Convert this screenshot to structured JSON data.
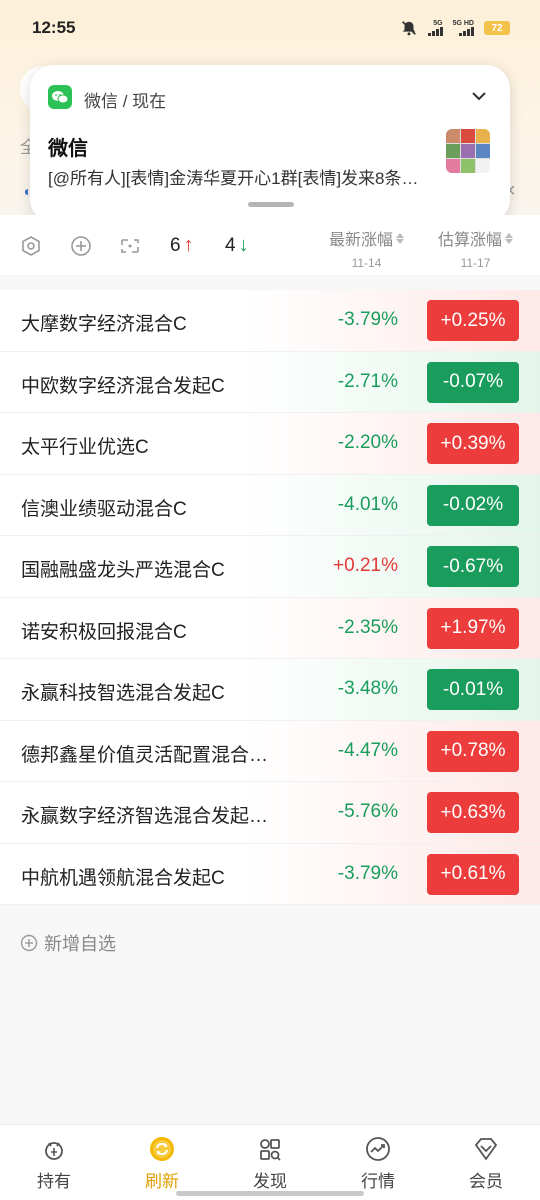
{
  "status_bar": {
    "time": "12:55",
    "signal1_label": "5G",
    "signal2_label": "5G HD",
    "battery": "72"
  },
  "notification": {
    "app_name": "微信 / 现在",
    "title": "微信",
    "body": "[@所有人][表情]金涛华夏开心1群[表情]发来8条…",
    "icon": "wechat-icon",
    "accent": "#2bc156"
  },
  "background_hints": {
    "all_tab": "全"
  },
  "toolbar": {
    "up_count": "6",
    "down_count": "4",
    "up_arrow": "↑",
    "down_arrow": "↓",
    "col_latest_label": "最新涨幅",
    "col_latest_date": "11-14",
    "col_estimate_label": "估算涨幅",
    "col_estimate_date": "11-17"
  },
  "funds": [
    {
      "name": "大摩数字经济混合C",
      "latest": "-3.79%",
      "estimate": "+0.25%"
    },
    {
      "name": "中欧数字经济混合发起C",
      "latest": "-2.71%",
      "estimate": "-0.07%"
    },
    {
      "name": "太平行业优选C",
      "latest": "-2.20%",
      "estimate": "+0.39%"
    },
    {
      "name": "信澳业绩驱动混合C",
      "latest": "-4.01%",
      "estimate": "-0.02%"
    },
    {
      "name": "国融融盛龙头严选混合C",
      "latest": "+0.21%",
      "estimate": "-0.67%"
    },
    {
      "name": "诺安积极回报混合C",
      "latest": "-2.35%",
      "estimate": "+1.97%"
    },
    {
      "name": "永赢科技智选混合发起C",
      "latest": "-3.48%",
      "estimate": "-0.01%"
    },
    {
      "name": "德邦鑫星价值灵活配置混合…",
      "latest": "-4.47%",
      "estimate": "+0.78%"
    },
    {
      "name": "永赢数字经济智选混合发起…",
      "latest": "-5.76%",
      "estimate": "+0.63%"
    },
    {
      "name": "中航机遇领航混合发起C",
      "latest": "-3.79%",
      "estimate": "+0.61%"
    }
  ],
  "add_fund_label": "新增自选",
  "bottom_nav": [
    {
      "label": "持有",
      "icon": "holdings-icon",
      "active": false
    },
    {
      "label": "刷新",
      "icon": "refresh-icon",
      "active": true
    },
    {
      "label": "发现",
      "icon": "discover-icon",
      "active": false
    },
    {
      "label": "行情",
      "icon": "market-icon",
      "active": false
    },
    {
      "label": "会员",
      "icon": "member-icon",
      "active": false
    }
  ],
  "colors": {
    "up": "#e23a3a",
    "down": "#1a9d5c",
    "active_nav": "#e0a100"
  }
}
